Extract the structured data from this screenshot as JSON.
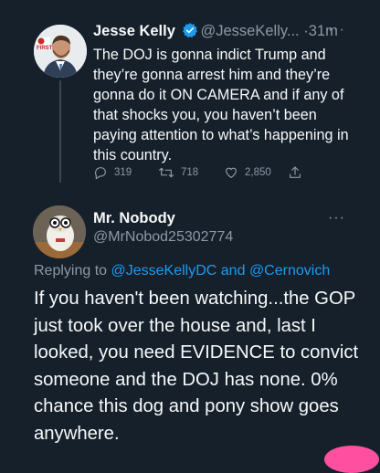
{
  "tweet": {
    "author_name": "Jesse Kelly",
    "author_handle": "@JesseKelly...",
    "separator": "·",
    "time": "31m",
    "more": "···",
    "avatar_badge": "FIRST",
    "body": "The DOJ is gonna indict Trump and they’re gonna arrest him and they’re gonna do it ON CAMERA and if any of that shocks you, you haven’t been paying attention to what’s happening in this country.",
    "replies": "319",
    "retweets": "718",
    "likes": "2,850"
  },
  "reply": {
    "author_name": "Mr. Nobody",
    "author_handle": "@MrNobod25302774",
    "more": "···",
    "replying_prefix": "Replying to",
    "replying_users": [
      "@JesseKellyDC",
      "@Cernovich"
    ],
    "replying_joiner": "and",
    "body": "If you haven't been watching...the GOP just took over the house and, last I looked, you need EVIDENCE to convict someone and the DOJ has none.  0% chance this dog and pony show goes anywhere."
  },
  "colors": {
    "background": "#15202b",
    "accent": "#1d9bf0",
    "muted": "#8b98a5"
  },
  "icons": [
    "verified-badge-icon",
    "reply-icon",
    "retweet-icon",
    "like-icon",
    "share-icon",
    "more-icon"
  ]
}
